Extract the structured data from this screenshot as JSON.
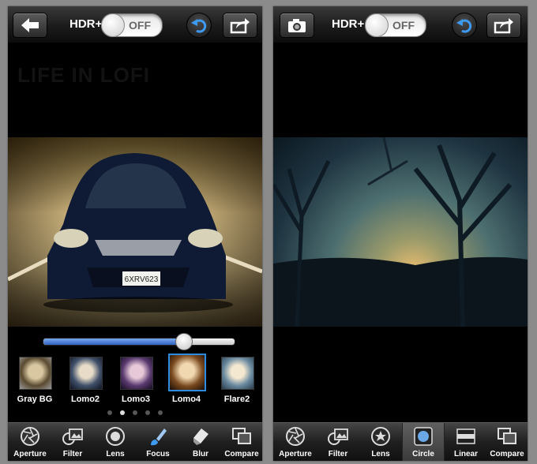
{
  "left_screen": {
    "hdr_label": "HDR+",
    "hdr_toggle": "OFF",
    "watermark": "LIFE IN LOFI",
    "license_plate": "6XRV623",
    "slider": {
      "value": 0.73
    },
    "filters": [
      {
        "label": "Gray BG",
        "selected": false
      },
      {
        "label": "Lomo2",
        "selected": false
      },
      {
        "label": "Lomo3",
        "selected": false
      },
      {
        "label": "Lomo4",
        "selected": true
      },
      {
        "label": "Flare2",
        "selected": false
      }
    ],
    "page_dots": {
      "count": 5,
      "active": 1
    },
    "tools": [
      {
        "label": "Aperture",
        "icon": "aperture-icon"
      },
      {
        "label": "Filter",
        "icon": "filter-icon"
      },
      {
        "label": "Lens",
        "icon": "lens-icon"
      },
      {
        "label": "Focus",
        "icon": "focus-brush-icon"
      },
      {
        "label": "Blur",
        "icon": "blur-eraser-icon"
      },
      {
        "label": "Compare",
        "icon": "compare-icon"
      }
    ]
  },
  "right_screen": {
    "hdr_label": "HDR+",
    "hdr_toggle": "OFF",
    "tools": [
      {
        "label": "Aperture",
        "icon": "aperture-icon"
      },
      {
        "label": "Filter",
        "icon": "filter-icon"
      },
      {
        "label": "Lens",
        "icon": "lens-star-icon"
      },
      {
        "label": "Circle",
        "icon": "circle-shape-icon",
        "selected": true
      },
      {
        "label": "Linear",
        "icon": "linear-shape-icon"
      },
      {
        "label": "Compare",
        "icon": "compare-icon"
      }
    ]
  },
  "colors": {
    "accent_blue": "#2d8be0",
    "slider_fill": "#3a6fd0"
  }
}
